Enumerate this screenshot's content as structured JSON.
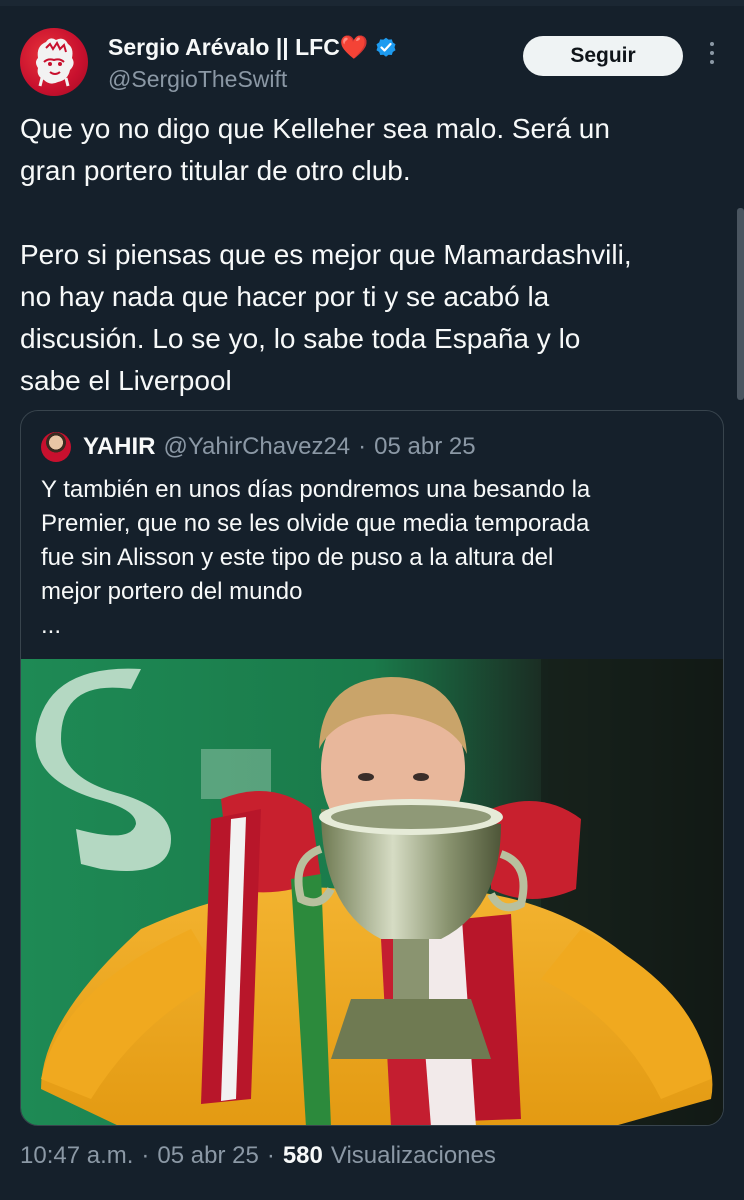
{
  "author": {
    "display_name": "Sergio Arévalo || LFC❤️",
    "handle": "@SergioTheSwift",
    "avatar_icon": "premier-league-lion-icon",
    "verified_icon": "verified-badge-icon"
  },
  "follow_label": "Seguir",
  "more_icon": "more-options-icon",
  "tweet_text": "Que yo no digo que Kelleher sea malo. Será un\ngran portero titular de otro club.\n\nPero si piensas que es mejor que Mamardashvili,\nno hay nada que hacer por ti y se acabó la\ndiscusión. Lo se yo, lo sabe toda España y lo\nsabe el Liverpool",
  "quoted": {
    "display_name": "YAHIR",
    "handle": "@YahirChavez24",
    "separator": "·",
    "date": "05 abr 25",
    "text": "Y también en unos días pondremos una besando la\nPremier, que no se les olvide que media temporada\nfue sin Alisson y este tipo de puso a la altura del\nmejor portero del mundo\n...",
    "image_description_icon": "goalkeeper-kissing-trophy-photo"
  },
  "meta": {
    "time": "10:47 a.m.",
    "sep1": "·",
    "date": "05 abr 25",
    "sep2": "·",
    "views_count": "580",
    "views_label": "Visualizaciones"
  },
  "colors": {
    "background": "#15202b",
    "text": "#f7f9f9",
    "secondary_text": "#8b98a5",
    "border": "#38444d",
    "verified": "#1d9bf0",
    "follow_bg": "#eff3f4"
  }
}
